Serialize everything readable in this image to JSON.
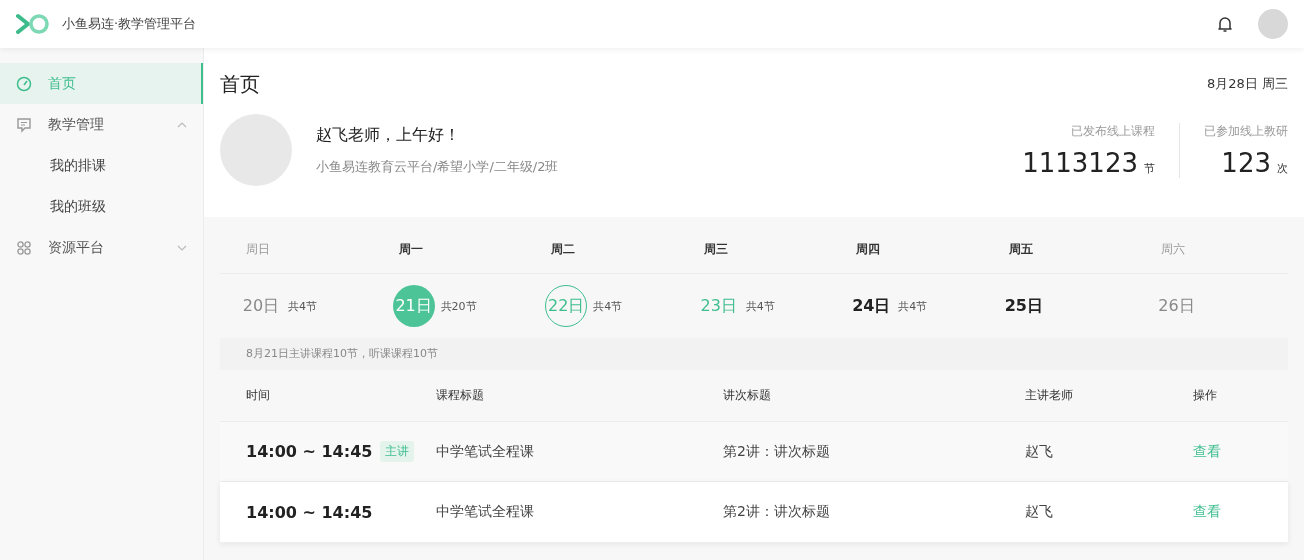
{
  "header": {
    "brand": "小鱼易连·教学管理平台"
  },
  "sidebar": {
    "items": [
      {
        "label": "首页",
        "kind": "dashboard",
        "selected": true
      },
      {
        "label": "教学管理",
        "kind": "chat",
        "selected": false,
        "expanded": true,
        "children": [
          {
            "label": "我的排课",
            "selected": false
          },
          {
            "label": "我的班级",
            "selected": false
          }
        ]
      },
      {
        "label": "资源平台",
        "kind": "grid",
        "selected": false,
        "expanded": false
      }
    ]
  },
  "page": {
    "title": "首页",
    "date": "8月28日 周三"
  },
  "profile": {
    "greeting": "赵飞老师，上午好！",
    "org": "小鱼易连教育云平台/希望小学/二年级/2班",
    "stats": [
      {
        "label": "已发布线上课程",
        "value": "1113123",
        "unit": "节"
      },
      {
        "label": "已参加线上教研",
        "value": "123",
        "unit": "次"
      }
    ]
  },
  "week": {
    "days": [
      {
        "weekday": "周日",
        "date": "20日",
        "count": "共4节",
        "kind": "muted",
        "selected": false
      },
      {
        "weekday": "周一",
        "date": "21日",
        "count": "共20节",
        "kind": "plain",
        "selected": true
      },
      {
        "weekday": "周二",
        "date": "22日",
        "count": "共4节",
        "kind": "ring",
        "selected": false
      },
      {
        "weekday": "周三",
        "date": "23日",
        "count": "共4节",
        "kind": "accent",
        "selected": false
      },
      {
        "weekday": "周四",
        "date": "24日",
        "count": "共4节",
        "kind": "plain",
        "selected": false
      },
      {
        "weekday": "周五",
        "date": "25日",
        "kind": "plain",
        "selected": false
      },
      {
        "weekday": "周六",
        "date": "26日",
        "kind": "muted",
        "selected": false
      }
    ],
    "summary": "8月21日主讲课程10节，听课课程10节"
  },
  "table": {
    "columns": [
      "时间",
      "课程标题",
      "讲次标题",
      "主讲老师",
      "操作"
    ],
    "rows": [
      {
        "time": "14:00 ~ 14:45",
        "tag": "主讲",
        "course": "中学笔试全程课",
        "lesson": "第2讲：讲次标题",
        "teacher": "赵飞",
        "action": "查看",
        "highlighted": false
      },
      {
        "time": "14:00 ~ 14:45",
        "course": "中学笔试全程课",
        "lesson": "第2讲：讲次标题",
        "teacher": "赵飞",
        "action": "查看",
        "highlighted": true
      }
    ]
  }
}
